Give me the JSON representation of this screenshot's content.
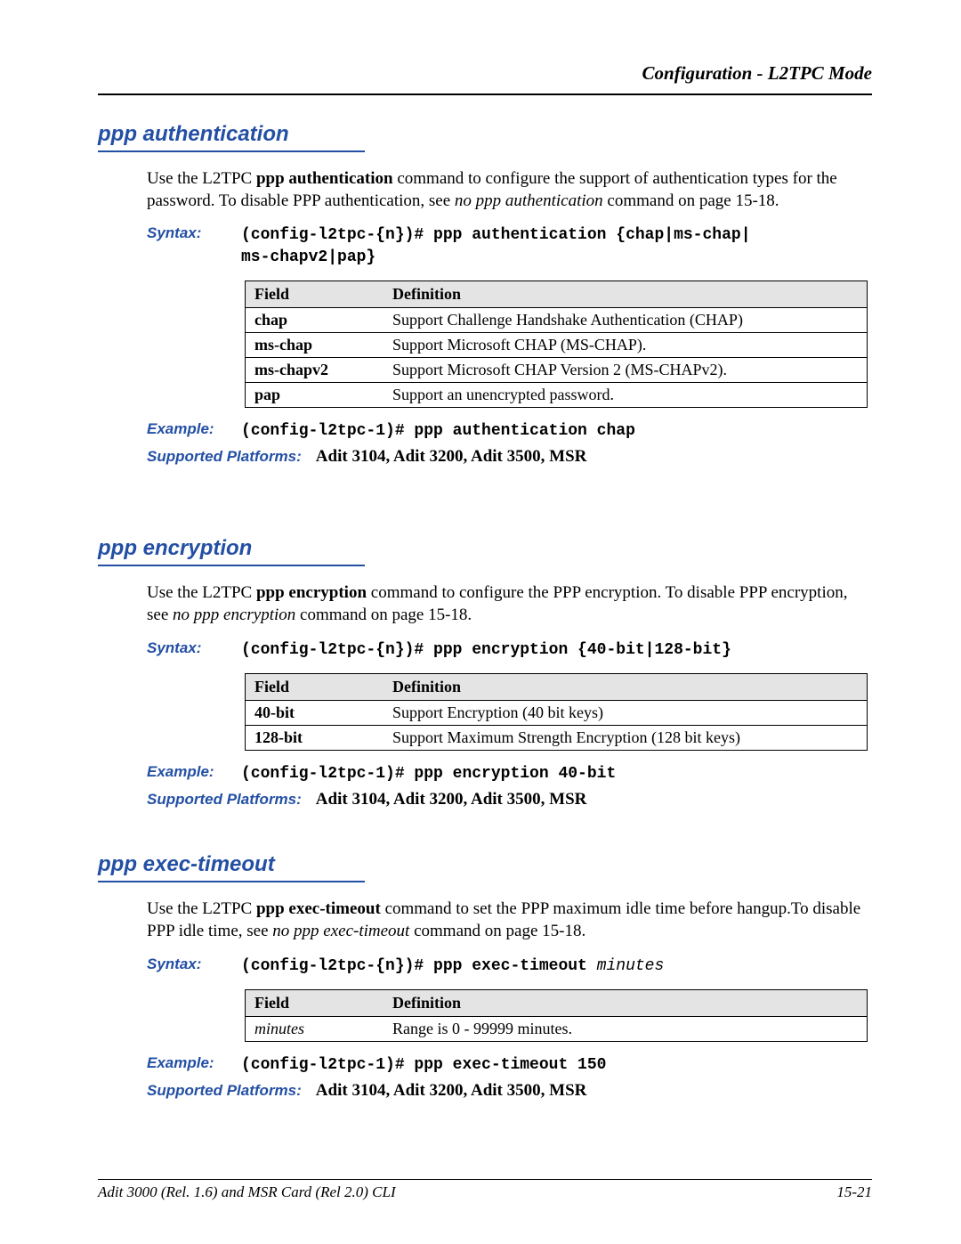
{
  "running_head": "Configuration - L2TPC Mode",
  "sections": {
    "auth": {
      "title": "ppp authentication",
      "intro_segments": [
        {
          "t": "Use the L2TPC "
        },
        {
          "t": "ppp authentication",
          "bold": true
        },
        {
          "t": " command to configure the support of authentication types for the password. To disable PPP authentication, see "
        },
        {
          "t": "no ppp authentication",
          "italic": true
        },
        {
          "t": " command on page 15-18."
        }
      ],
      "syntax_label": "Syntax:",
      "syntax_code": "(config-l2tpc-{n})# ppp authentication {chap|ms-chap|\nms-chapv2|pap}",
      "table": {
        "headers": [
          "Field",
          "Definition"
        ],
        "rows": [
          {
            "field": "chap",
            "def": "Support Challenge Handshake Authentication (CHAP)"
          },
          {
            "field": "ms-chap",
            "def": "Support Microsoft CHAP (MS-CHAP)."
          },
          {
            "field": "ms-chapv2",
            "def": "Support Microsoft CHAP Version 2 (MS-CHAPv2)."
          },
          {
            "field": "pap",
            "def": "Support an unencrypted password."
          }
        ]
      },
      "example_label": "Example:",
      "example_code": "(config-l2tpc-1)# ppp authentication chap",
      "platforms_label": "Supported Platforms:",
      "platforms_val": "Adit 3104, Adit 3200, Adit 3500, MSR"
    },
    "enc": {
      "title": "ppp encryption",
      "intro_segments": [
        {
          "t": "Use the L2TPC "
        },
        {
          "t": "ppp encryption",
          "bold": true
        },
        {
          "t": " command to configure the PPP encryption. To disable PPP encryption, see "
        },
        {
          "t": "no ppp encryption",
          "italic": true
        },
        {
          "t": " command on page 15-18."
        }
      ],
      "syntax_label": "Syntax:",
      "syntax_code": "(config-l2tpc-{n})# ppp encryption {40-bit|128-bit}",
      "table": {
        "headers": [
          "Field",
          "Definition"
        ],
        "rows": [
          {
            "field": "40-bit",
            "def": "Support Encryption (40 bit keys)"
          },
          {
            "field": "128-bit",
            "def": "Support Maximum Strength Encryption (128 bit keys)"
          }
        ]
      },
      "example_label": "Example:",
      "example_code": "(config-l2tpc-1)# ppp encryption 40-bit",
      "platforms_label": "Supported Platforms:",
      "platforms_val": "Adit 3104, Adit 3200, Adit 3500, MSR"
    },
    "tout": {
      "title": "ppp exec-timeout",
      "intro_segments": [
        {
          "t": "Use the L2TPC "
        },
        {
          "t": "ppp exec-timeout",
          "bold": true
        },
        {
          "t": " command to set the PPP maximum idle time before hangup.To disable PPP idle time, see "
        },
        {
          "t": "no ppp exec-timeout",
          "italic": true
        },
        {
          "t": " command on page 15-18."
        }
      ],
      "syntax_label": "Syntax:",
      "syntax_code_pre": "(config-l2tpc-{n})# ppp exec-timeout ",
      "syntax_code_arg": "minutes",
      "table": {
        "headers": [
          "Field",
          "Definition"
        ],
        "rows": [
          {
            "field": "minutes",
            "italic_field": true,
            "def": "Range is 0 - 99999 minutes."
          }
        ]
      },
      "example_label": "Example:",
      "example_code": "(config-l2tpc-1)# ppp exec-timeout 150",
      "platforms_label": "Supported Platforms:",
      "platforms_val": "Adit 3104, Adit 3200, Adit 3500, MSR"
    }
  },
  "footer": {
    "left": "Adit 3000 (Rel. 1.6) and MSR Card (Rel 2.0) CLI",
    "right": "15-21"
  }
}
